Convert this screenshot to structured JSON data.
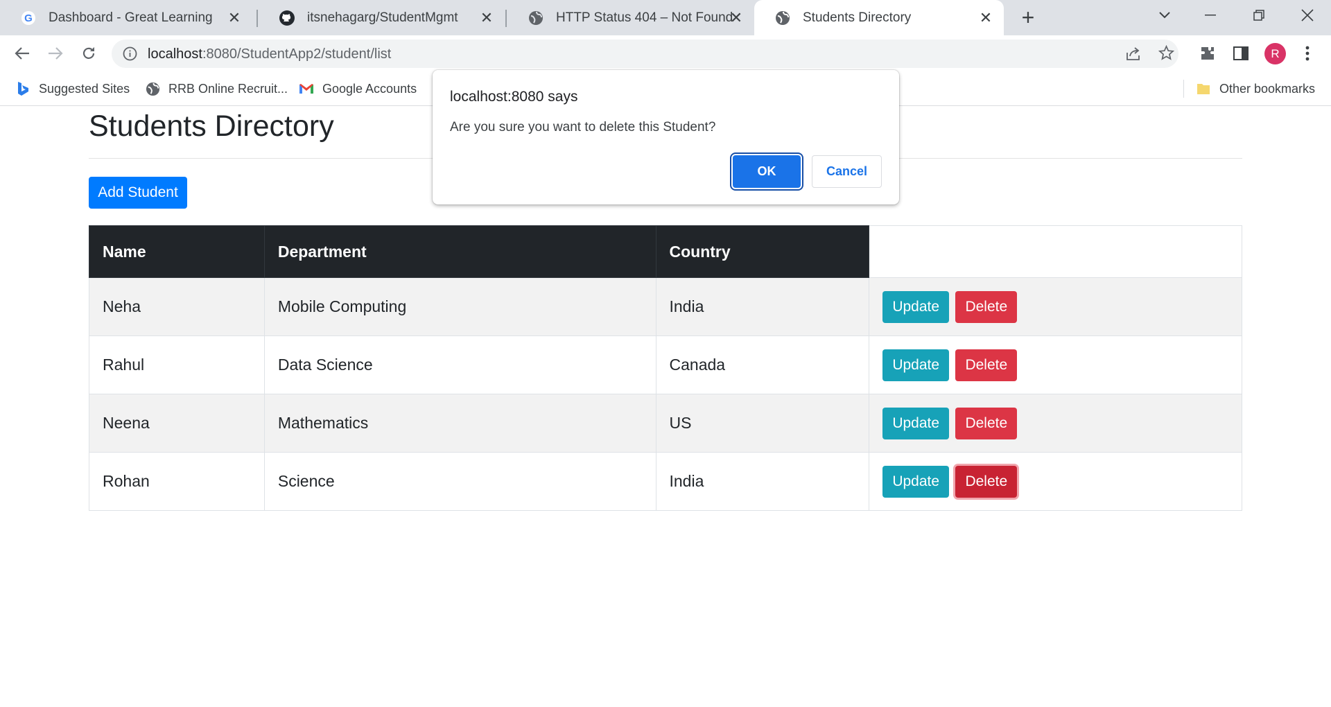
{
  "browser": {
    "tabs": [
      {
        "title": "Dashboard - Great Learning",
        "favicon": "google-g-icon"
      },
      {
        "title": "itsnehagarg/StudentMgmt",
        "favicon": "github-icon"
      },
      {
        "title": "HTTP Status 404 – Not Found",
        "favicon": "globe-icon"
      },
      {
        "title": "Students Directory",
        "favicon": "globe-icon",
        "active": true
      }
    ],
    "address": {
      "host": "localhost",
      "rest": ":8080/StudentApp2/student/list"
    },
    "profile_initial": "R",
    "bookmarks": [
      {
        "label": "Suggested Sites",
        "icon": "bing-icon"
      },
      {
        "label": "RRB Online Recruit...",
        "icon": "globe-icon"
      },
      {
        "label": "Google Accounts",
        "icon": "gmail-icon"
      }
    ],
    "other_bookmarks": "Other bookmarks"
  },
  "page": {
    "title": "Students Directory",
    "add_button": "Add Student",
    "table": {
      "headers": [
        "Name",
        "Department",
        "Country"
      ],
      "rows": [
        {
          "name": "Neha",
          "department": "Mobile Computing",
          "country": "India"
        },
        {
          "name": "Rahul",
          "department": "Data Science",
          "country": "Canada"
        },
        {
          "name": "Neena",
          "department": "Mathematics",
          "country": "US"
        },
        {
          "name": "Rohan",
          "department": "Science",
          "country": "India"
        }
      ],
      "update_label": "Update",
      "delete_label": "Delete"
    }
  },
  "dialog": {
    "title": "localhost:8080 says",
    "message": "Are you sure you want to delete this Student?",
    "ok": "OK",
    "cancel": "Cancel"
  },
  "colors": {
    "primary": "#007bff",
    "info": "#17a2b8",
    "danger": "#dc3545",
    "dark": "#212529",
    "chrome_blue": "#1a73e8"
  }
}
